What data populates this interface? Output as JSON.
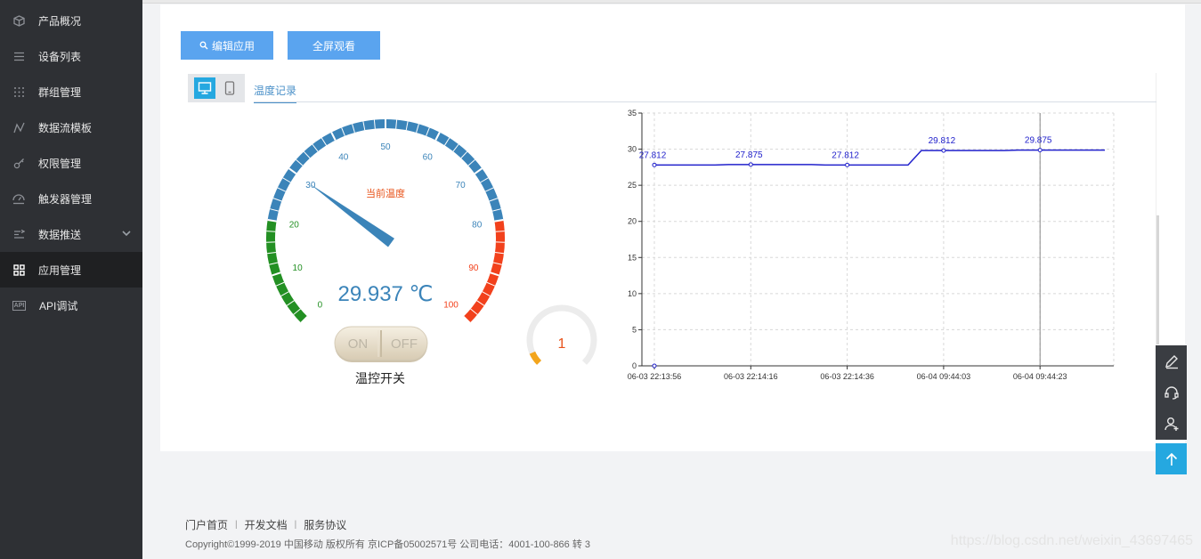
{
  "sidebar": {
    "items": [
      {
        "label": "产品概况",
        "icon": "cube-icon"
      },
      {
        "label": "设备列表",
        "icon": "list-icon"
      },
      {
        "label": "群组管理",
        "icon": "grid-dots-icon"
      },
      {
        "label": "数据流模板",
        "icon": "flow-icon"
      },
      {
        "label": "权限管理",
        "icon": "key-icon"
      },
      {
        "label": "触发器管理",
        "icon": "trigger-icon"
      },
      {
        "label": "数据推送",
        "icon": "push-icon"
      },
      {
        "label": "应用管理",
        "icon": "apps-icon"
      },
      {
        "label": "API调试",
        "icon": "api-icon"
      }
    ],
    "api_badge": "API",
    "active_index": 7
  },
  "toolbar": {
    "edit_label": "编辑应用",
    "fullscreen_label": "全屏观看"
  },
  "widget": {
    "tab_label": "温度记录"
  },
  "gauge": {
    "title": "当前温度",
    "value": 29.937,
    "value_text": "29.937 ℃",
    "min": 0,
    "max": 100,
    "tick_labels": [
      "0",
      "10",
      "20",
      "30",
      "40",
      "50",
      "60",
      "70",
      "80",
      "90",
      "100"
    ],
    "colors": {
      "low": "#239023",
      "mid": "#3b84b9",
      "high": "#f2411c"
    }
  },
  "switch": {
    "on_label": "ON",
    "off_label": "OFF",
    "title": "温控开关"
  },
  "mini_gauge": {
    "value": 1,
    "value_text": "1",
    "max": 100,
    "color": "#f3a51c"
  },
  "chart_data": {
    "type": "line",
    "x": [
      "06-03 22:13:56",
      "06-03 22:14:16",
      "06-03 22:14:36",
      "06-04 09:44:03",
      "06-04 09:44:23"
    ],
    "points": [
      {
        "x": "06-03 22:13:56",
        "y": 0
      },
      {
        "x": "06-03 22:13:56",
        "y": 27.812
      },
      {
        "x": "06-03 22:14:16",
        "y": 27.875
      },
      {
        "x": "06-03 22:14:36",
        "y": 27.812
      },
      {
        "x": "06-04 09:44:03",
        "y": 29.812
      },
      {
        "x": "06-04 09:44:23",
        "y": 29.875
      }
    ],
    "data_labels": [
      "27.812",
      "27.875",
      "27.812",
      "29.812",
      "29.875"
    ],
    "ylim": [
      0,
      35
    ],
    "yticks": [
      "0",
      "5",
      "10",
      "15",
      "20",
      "25",
      "30",
      "35"
    ],
    "grid": true,
    "line_color": "#2222cc"
  },
  "footer": {
    "links": [
      "门户首页",
      "开发文档",
      "服务协议"
    ],
    "separator": "|",
    "copyright": "Copyright©1999-2019 中国移动 版权所有 京ICP备05002571号 公司电话：4001-100-866 转 3",
    "watermark": "https://blog.csdn.net/weixin_43697465"
  }
}
